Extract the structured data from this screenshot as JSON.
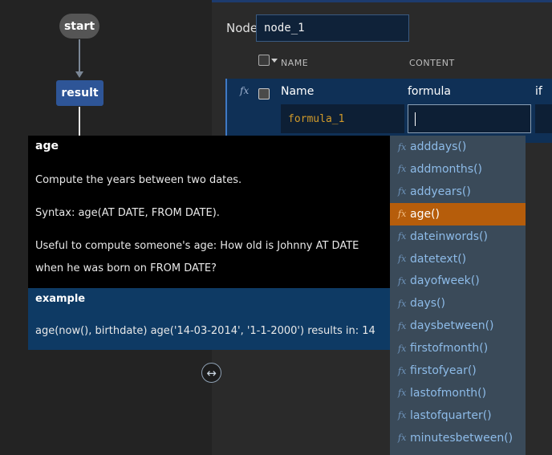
{
  "flow": {
    "nodes": [
      {
        "label": "start"
      },
      {
        "label": "result"
      }
    ]
  },
  "node_field": {
    "label": "Node",
    "value": "node_1"
  },
  "table": {
    "headers": {
      "name": "NAME",
      "content": "CONTENT"
    },
    "row": {
      "fx_icon": "fx",
      "name_label": "Name",
      "formula_label": "formula",
      "if_label": "if",
      "name_value": "formula_1",
      "formula_value": ""
    }
  },
  "tooltip": {
    "title": "age",
    "description": "Compute the years between two dates.",
    "syntax": "Syntax: age(AT DATE, FROM DATE).",
    "usage": "Useful to compute someone's age: How old is Johnny AT DATE when he was born on FROM DATE?",
    "example_title": "example",
    "example_text": "age(now(), birthdate) age('14-03-2014', '1-1-2000') results in: 14"
  },
  "resize_icon": "↔",
  "autocomplete": {
    "selected_index": 3,
    "items": [
      {
        "icon": "fx",
        "label": "adddays()"
      },
      {
        "icon": "fx",
        "label": "addmonths()"
      },
      {
        "icon": "fx",
        "label": "addyears()"
      },
      {
        "icon": "fx",
        "label": "age()"
      },
      {
        "icon": "fx",
        "label": "dateinwords()"
      },
      {
        "icon": "fx",
        "label": "datetext()"
      },
      {
        "icon": "fx",
        "label": "dayofweek()"
      },
      {
        "icon": "fx",
        "label": "days()"
      },
      {
        "icon": "fx",
        "label": "daysbetween()"
      },
      {
        "icon": "fx",
        "label": "firstofmonth()"
      },
      {
        "icon": "fx",
        "label": "firstofyear()"
      },
      {
        "icon": "fx",
        "label": "lastofmonth()"
      },
      {
        "icon": "fx",
        "label": "lastofquarter()"
      },
      {
        "icon": "fx",
        "label": "minutesbetween()"
      }
    ]
  },
  "colors": {
    "accent": "#2e5597",
    "selected": "#b65d0b",
    "row_bg": "#0f3056"
  }
}
